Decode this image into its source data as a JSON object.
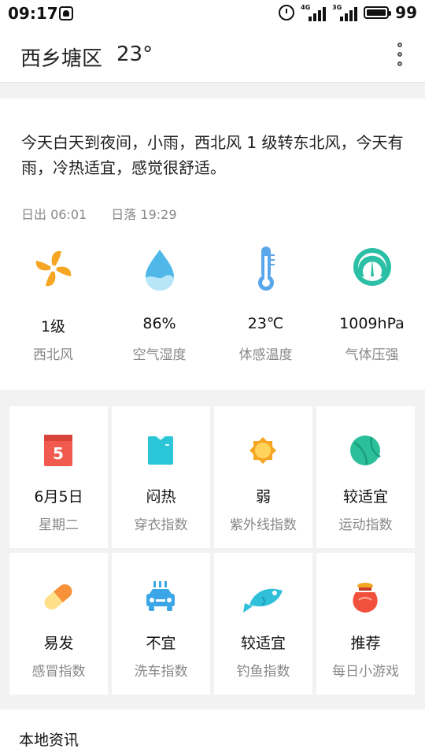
{
  "status_bar": {
    "time": "09:17",
    "battery": "99",
    "net1": "4G",
    "net2": "3G"
  },
  "header": {
    "city": "西乡塘区",
    "temperature": "23°"
  },
  "summary": {
    "text": "今天白天到夜间，小雨，西北风 1 级转东北风，今天有雨，冷热适宜，感觉很舒适。",
    "sunrise": "日出 06:01",
    "sunset": "日落 19:29"
  },
  "metrics": [
    {
      "icon": "wind-icon",
      "value": "1级",
      "label": "西北风"
    },
    {
      "icon": "humidity-drop-icon",
      "value": "86%",
      "label": "空气湿度"
    },
    {
      "icon": "thermometer-icon",
      "value": "23℃",
      "label": "体感温度"
    },
    {
      "icon": "pressure-gauge-icon",
      "value": "1009hPa",
      "label": "气体压强"
    }
  ],
  "indices": [
    {
      "icon": "calendar-icon",
      "icon_text": "5",
      "value": "6月5日",
      "label": "星期二"
    },
    {
      "icon": "shirt-icon",
      "value": "闷热",
      "label": "穿衣指数"
    },
    {
      "icon": "sun-icon",
      "value": "弱",
      "label": "紫外线指数"
    },
    {
      "icon": "ball-icon",
      "value": "较适宜",
      "label": "运动指数"
    },
    {
      "icon": "pill-icon",
      "value": "易发",
      "label": "感冒指数"
    },
    {
      "icon": "car-wash-icon",
      "value": "不宜",
      "label": "洗车指数"
    },
    {
      "icon": "fish-icon",
      "value": "较适宜",
      "label": "钓鱼指数"
    },
    {
      "icon": "lucky-bag-icon",
      "value": "推荐",
      "label": "每日小游戏"
    }
  ],
  "news": {
    "title": "本地资讯"
  },
  "colors": {
    "wind": "#f5a623",
    "humidity": "#4fb8e8",
    "thermo": "#5aa6ea",
    "gauge": "#2bbfa5",
    "calendar": "#f05a4f",
    "shirt": "#2ac6d8",
    "sun": "#f5a623",
    "ball": "#2bbf9a",
    "pill": "#f7913a",
    "car": "#3aa6e8",
    "fish": "#2fbfd8",
    "bag": "#f0503c"
  }
}
